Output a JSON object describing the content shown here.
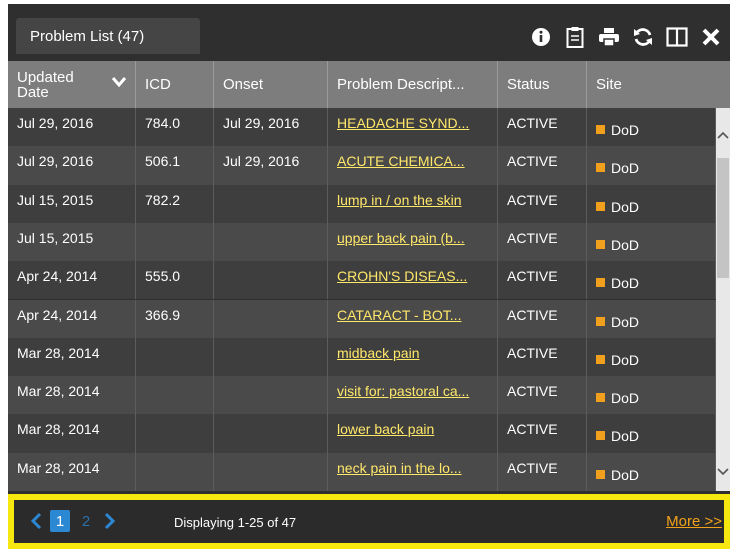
{
  "panel": {
    "title": "Problem List (47)",
    "toolbar_icons": [
      "info-icon",
      "clipboard-icon",
      "print-icon",
      "refresh-icon",
      "split-view-icon",
      "close-icon"
    ]
  },
  "columns": [
    {
      "key": "updated",
      "label": "Updated Date"
    },
    {
      "key": "icd",
      "label": "ICD"
    },
    {
      "key": "onset",
      "label": "Onset"
    },
    {
      "key": "desc",
      "label": "Problem Descript..."
    },
    {
      "key": "status",
      "label": "Status"
    },
    {
      "key": "site",
      "label": "Site"
    }
  ],
  "header": {
    "updated_line1": "Updated",
    "updated_line2": "Date",
    "icd": "ICD",
    "onset": "Onset",
    "desc": "Problem Descript...",
    "status": "Status",
    "site": "Site"
  },
  "rows": [
    {
      "updated": "Jul 29, 2016",
      "icd": "784.0",
      "onset": "Jul 29, 2016",
      "desc": "HEADACHE SYND...",
      "status": "ACTIVE",
      "site": "DoD"
    },
    {
      "updated": "Jul 29, 2016",
      "icd": "506.1",
      "onset": "Jul 29, 2016",
      "desc": "ACUTE CHEMICA...",
      "status": "ACTIVE",
      "site": "DoD"
    },
    {
      "updated": "Jul 15, 2015",
      "icd": "782.2",
      "onset": "",
      "desc": "lump in / on the skin",
      "status": "ACTIVE",
      "site": "DoD"
    },
    {
      "updated": "Jul 15, 2015",
      "icd": "",
      "onset": "",
      "desc": "upper back pain (b...",
      "status": "ACTIVE",
      "site": "DoD"
    },
    {
      "updated": "Apr 24, 2014",
      "icd": "555.0",
      "onset": "",
      "desc": "CROHN'S DISEAS...",
      "status": "ACTIVE",
      "site": "DoD"
    },
    {
      "updated": "Apr 24, 2014",
      "icd": "366.9",
      "onset": "",
      "desc": "CATARACT - BOT...",
      "status": "ACTIVE",
      "site": "DoD"
    },
    {
      "updated": "Mar 28, 2014",
      "icd": "",
      "onset": "",
      "desc": "midback pain",
      "status": "ACTIVE",
      "site": "DoD"
    },
    {
      "updated": "Mar 28, 2014",
      "icd": "",
      "onset": "",
      "desc": "visit for: pastoral ca...",
      "status": "ACTIVE",
      "site": "DoD"
    },
    {
      "updated": "Mar 28, 2014",
      "icd": "",
      "onset": "",
      "desc": "lower back pain",
      "status": "ACTIVE",
      "site": "DoD"
    },
    {
      "updated": "Mar 28, 2014",
      "icd": "",
      "onset": "",
      "desc": "neck pain in the lo...",
      "status": "ACTIVE",
      "site": "DoD"
    }
  ],
  "footer": {
    "pages": [
      "1",
      "2"
    ],
    "current_page": "1",
    "displaying": "Displaying 1-25 of 47",
    "more": "More >>"
  },
  "colors": {
    "highlight_border": "#f6e80e",
    "link": "#ffe86a",
    "site_marker": "#f0a01c",
    "active_page": "#2d88d4",
    "more_link": "#f2a31b"
  }
}
